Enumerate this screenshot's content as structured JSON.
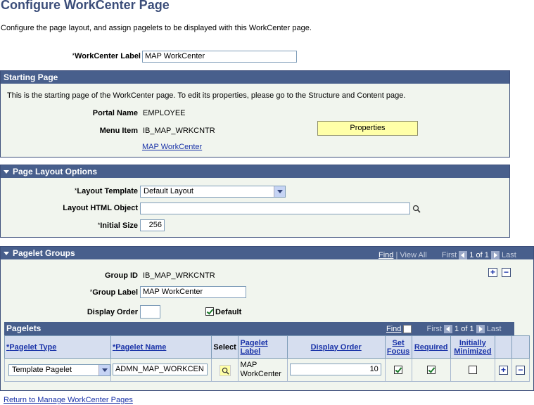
{
  "page": {
    "title": "Configure WorkCenter Page",
    "description": "Configure the page layout, and assign pagelets to be displayed with this WorkCenter page.",
    "workcenter_label_label": "WorkCenter Label",
    "workcenter_label_value": "MAP WorkCenter",
    "required_marker": "*"
  },
  "starting_page": {
    "header": "Starting Page",
    "info": "This is the starting page of the WorkCenter page. To edit its properties, please go to the Structure and Content page.",
    "portal_name_label": "Portal Name",
    "portal_name_value": "EMPLOYEE",
    "menu_item_label": "Menu Item",
    "menu_item_value": "IB_MAP_WRKCNTR",
    "link_label": "MAP WorkCenter",
    "properties_button": "Properties"
  },
  "layout_options": {
    "header": "Page Layout Options",
    "layout_template_label": "Layout Template",
    "layout_template_value": "Default Layout",
    "layout_html_label": "Layout HTML Object",
    "layout_html_value": "",
    "initial_size_label": "Initial Size",
    "initial_size_value": "256"
  },
  "pagelet_groups": {
    "header": "Pagelet Groups",
    "find": "Find",
    "separator": "|",
    "view_all": "View All",
    "first": "First",
    "range": "1 of 1",
    "last": "Last",
    "group_id_label": "Group ID",
    "group_id_value": "IB_MAP_WRKCNTR",
    "group_label_label": "Group Label",
    "group_label_value": "MAP WorkCenter",
    "display_order_label": "Display Order",
    "display_order_value": "",
    "default_label": "Default",
    "default_checked": true
  },
  "pagelets": {
    "header": "Pagelets",
    "find": "Find",
    "first": "First",
    "range": "1 of 1",
    "last": "Last",
    "columns": {
      "pagelet_type": "Pagelet Type",
      "pagelet_name": "Pagelet Name",
      "select": "Select",
      "pagelet_label_1": "Pagelet",
      "pagelet_label_2": "Label",
      "display_order": "Display Order",
      "set_focus_1": "Set",
      "set_focus_2": "Focus",
      "required": "Required",
      "initially_minimized_1": "Initially",
      "initially_minimized_2": "Minimized"
    },
    "rows": [
      {
        "pagelet_type": "Template Pagelet",
        "pagelet_name": "ADMN_MAP_WORKCEN",
        "pagelet_label_1": "MAP",
        "pagelet_label_2": "WorkCenter",
        "display_order": "10",
        "set_focus": true,
        "required": true,
        "initially_minimized": false
      }
    ]
  },
  "footer": {
    "return_link": "Return to Manage WorkCenter Pages"
  },
  "colors": {
    "section_header_bg": "#485f8c",
    "section_bg": "#f1f5ee",
    "link": "#1a33a8",
    "button_bg": "#ffffa8"
  }
}
